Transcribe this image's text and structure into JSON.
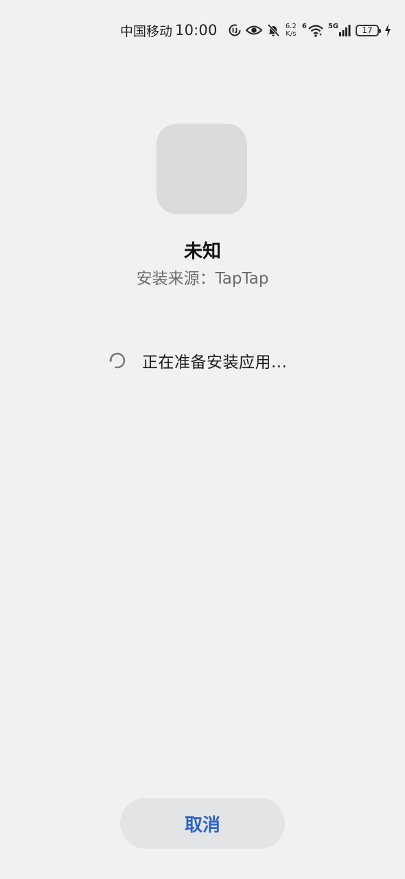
{
  "status_bar": {
    "carrier": "中国移动",
    "time": "10:00",
    "net_speed_value": "6.2",
    "net_speed_unit": "K/s",
    "wifi_label": "6",
    "cellular_label": "5G",
    "battery_level": "17",
    "icons": [
      "data-saver-icon",
      "eye-comfort-icon",
      "mute-bell-icon",
      "wifi-icon",
      "cellular-signal-icon",
      "battery-icon",
      "charging-bolt-icon"
    ]
  },
  "app": {
    "name": "未知",
    "source": "安装来源：TapTap"
  },
  "progress": {
    "text": "正在准备安装应用..."
  },
  "actions": {
    "cancel_label": "取消"
  },
  "colors": {
    "background": "#f0f1f3",
    "accent": "#2a62c9",
    "icon_placeholder": "#dadbdd"
  }
}
